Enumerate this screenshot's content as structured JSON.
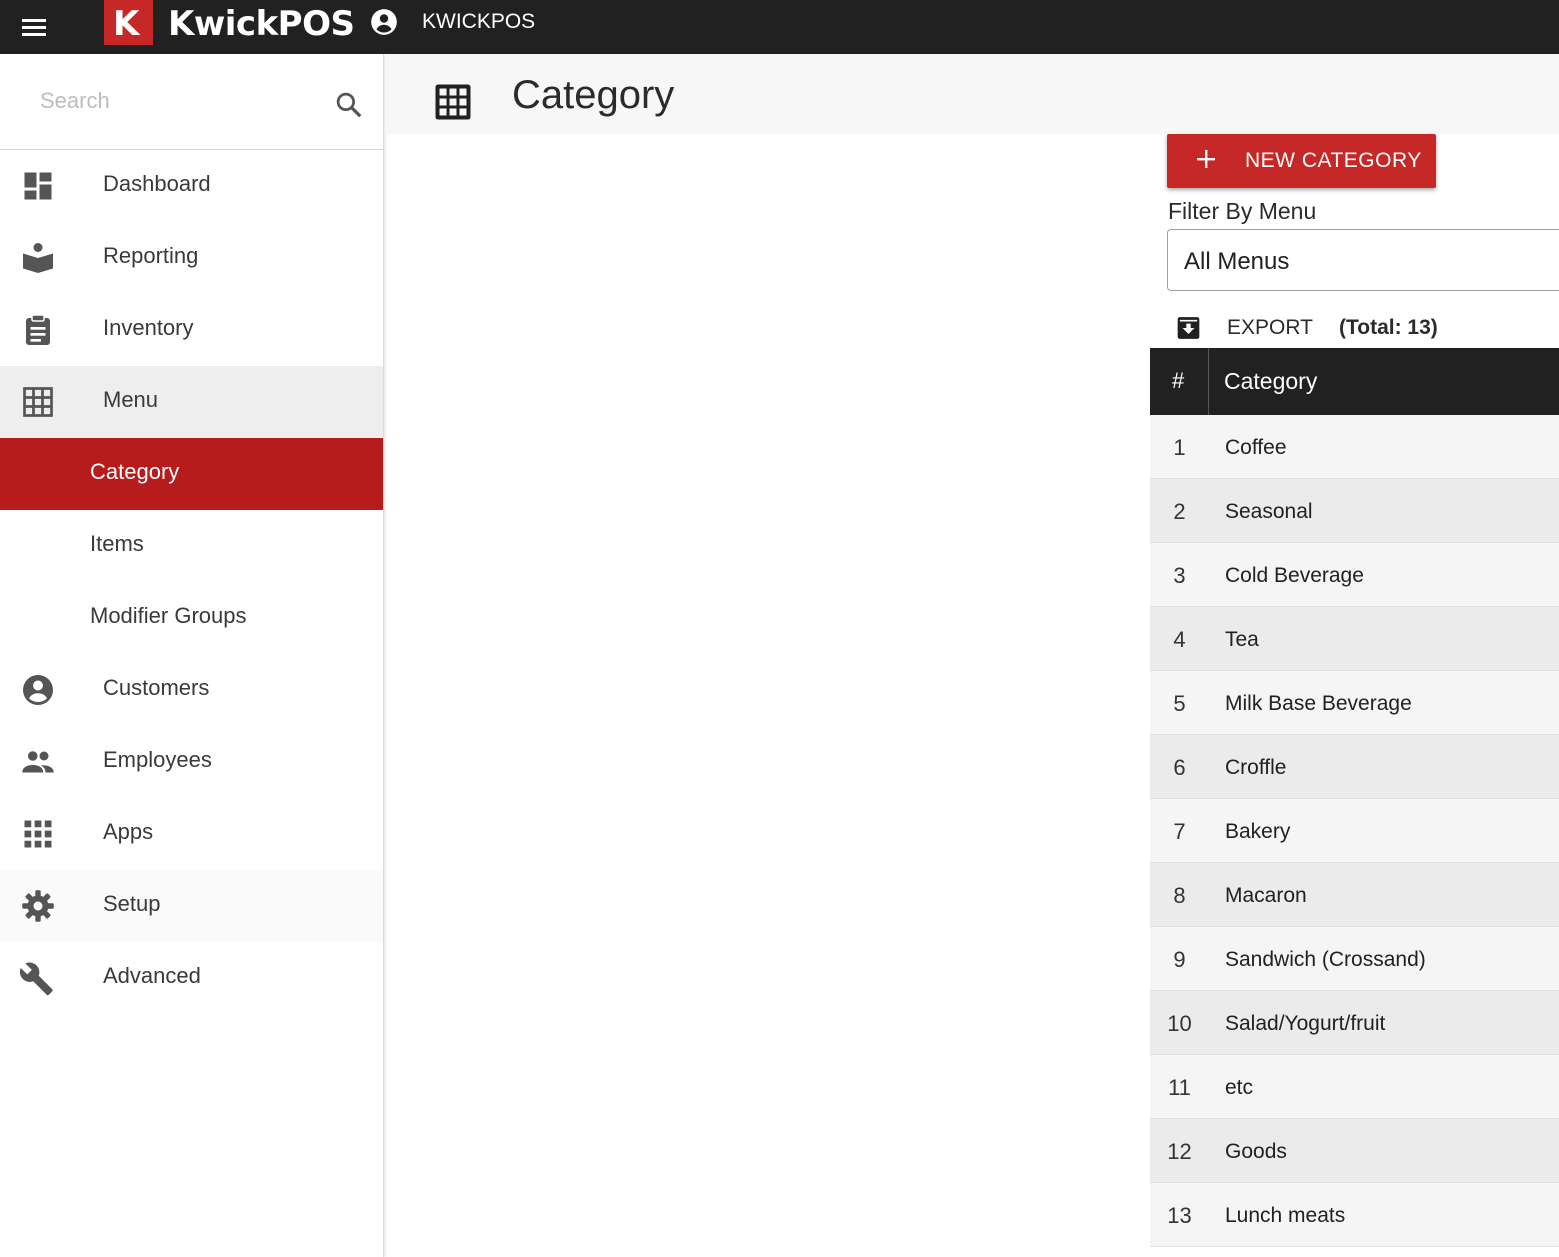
{
  "topbar": {
    "logo_letter": "K",
    "brand": "KwickPOS",
    "account_name": "KWICKPOS"
  },
  "sidebar": {
    "search_placeholder": "Search",
    "items": [
      {
        "label": "Dashboard",
        "icon": "dashboard-icon"
      },
      {
        "label": "Reporting",
        "icon": "reporting-icon"
      },
      {
        "label": "Inventory",
        "icon": "clipboard-icon"
      },
      {
        "label": "Menu",
        "icon": "grid-icon"
      },
      {
        "label": "Category",
        "icon": ""
      },
      {
        "label": "Items",
        "icon": ""
      },
      {
        "label": "Modifier Groups",
        "icon": ""
      },
      {
        "label": "Customers",
        "icon": "account-circle-icon"
      },
      {
        "label": "Employees",
        "icon": "people-icon"
      },
      {
        "label": "Apps",
        "icon": "apps-icon"
      },
      {
        "label": "Setup",
        "icon": "gear-icon"
      },
      {
        "label": "Advanced",
        "icon": "wrench-icon"
      }
    ],
    "active": "Category"
  },
  "header": {
    "title": "Category"
  },
  "actions": {
    "new_category_label": "NEW CATEGORY",
    "filter_label": "Filter By Menu",
    "filter_value": "All Menus",
    "export_label": "EXPORT",
    "total_label": "(Total: 13)"
  },
  "table": {
    "columns": [
      "#",
      "Category"
    ],
    "rows": [
      {
        "num": "1",
        "name": "Coffee"
      },
      {
        "num": "2",
        "name": "Seasonal"
      },
      {
        "num": "3",
        "name": "Cold Beverage"
      },
      {
        "num": "4",
        "name": "Tea"
      },
      {
        "num": "5",
        "name": "Milk Base Beverage"
      },
      {
        "num": "6",
        "name": "Croffle"
      },
      {
        "num": "7",
        "name": "Bakery"
      },
      {
        "num": "8",
        "name": "Macaron"
      },
      {
        "num": "9",
        "name": "Sandwich (Crossand)"
      },
      {
        "num": "10",
        "name": "Salad/Yogurt/fruit"
      },
      {
        "num": "11",
        "name": "etc"
      },
      {
        "num": "12",
        "name": "Goods"
      },
      {
        "num": "13",
        "name": "Lunch meats"
      }
    ]
  },
  "colors": {
    "topbar": "#212121",
    "accent": "#c62828",
    "active_nav": "#b71c1c"
  }
}
